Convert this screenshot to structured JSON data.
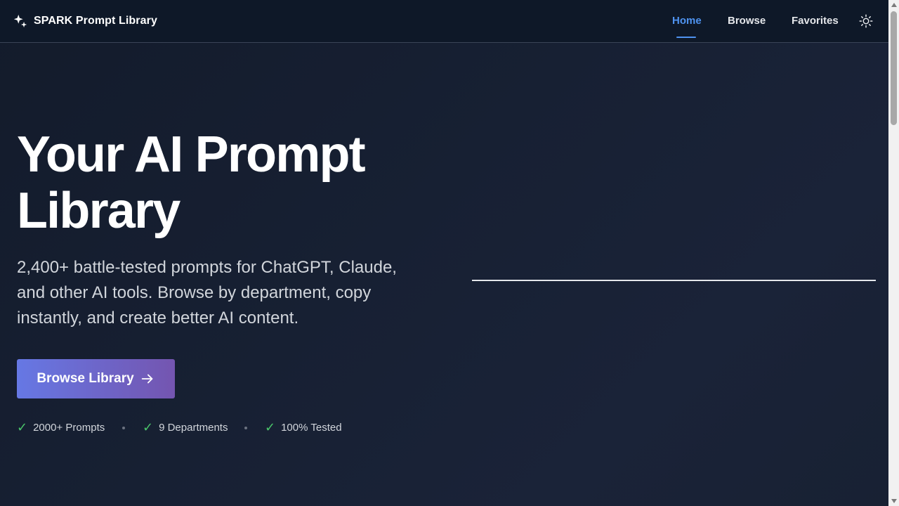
{
  "header": {
    "brand": "SPARK Prompt Library",
    "nav": [
      {
        "label": "Home",
        "active": true
      },
      {
        "label": "Browse",
        "active": false
      },
      {
        "label": "Favorites",
        "active": false
      }
    ],
    "theme_toggle_icon": "sun-icon"
  },
  "hero": {
    "title_line1": "Your AI Prompt",
    "title_line2": "Library",
    "subtitle": "2,400+ battle-tested prompts for ChatGPT, Claude, and other AI tools. Browse by department, copy instantly, and create better AI content.",
    "cta_label": "Browse Library",
    "cta_icon": "arrow-right-icon",
    "stats": [
      "2000+ Prompts",
      "9 Departments",
      "100% Tested"
    ]
  },
  "colors": {
    "accent": "#4f93f0",
    "cta_start": "#6678e4",
    "cta_end": "#7455b0",
    "check": "#4ac46a",
    "background": "#172033"
  }
}
